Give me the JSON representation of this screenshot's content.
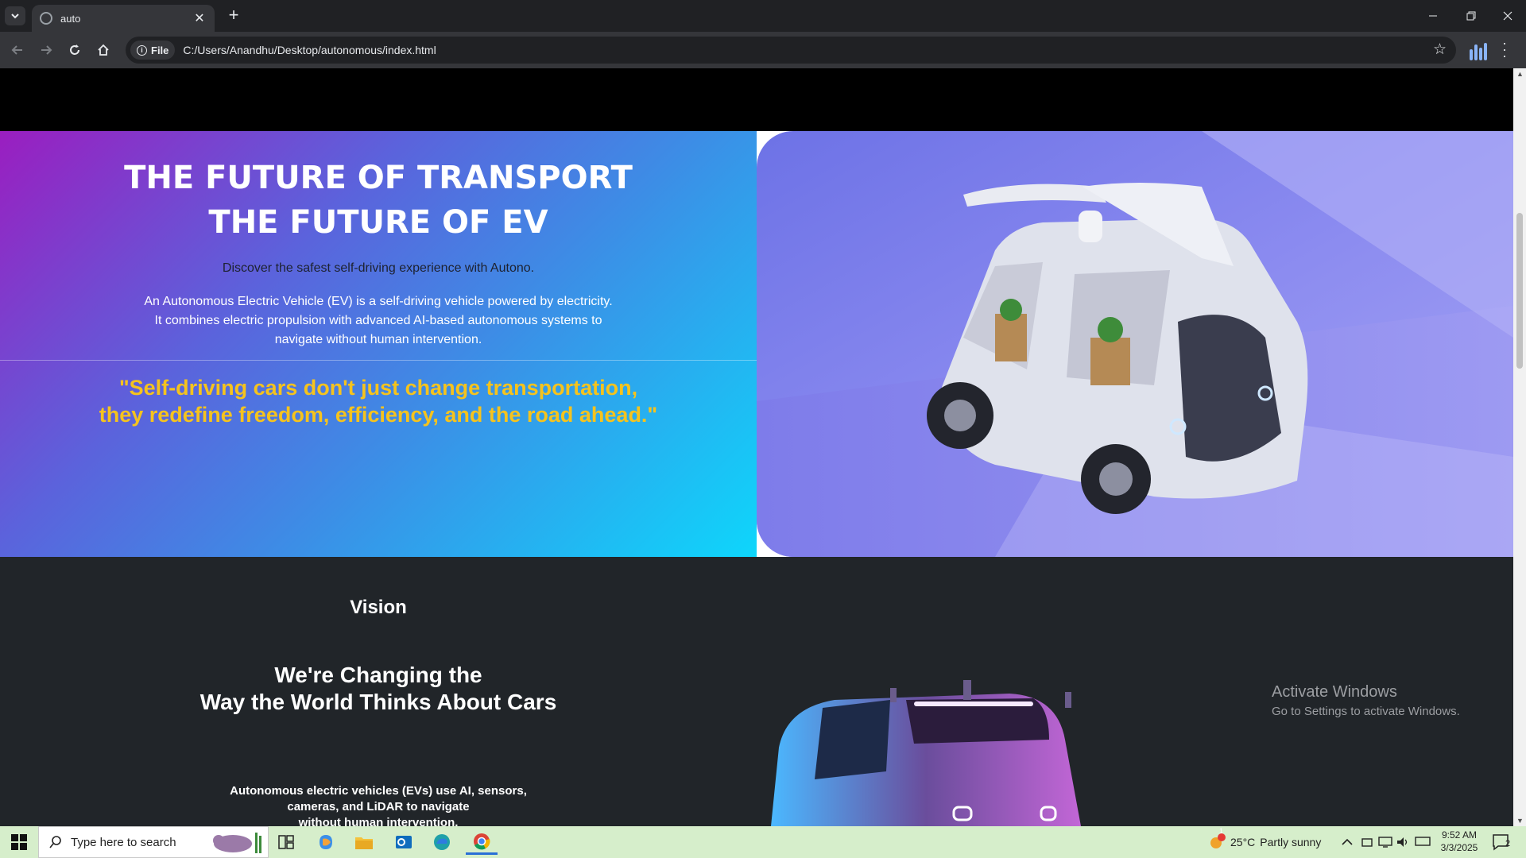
{
  "browser": {
    "tab_title": "auto",
    "new_tab": "+",
    "chip_label": "File",
    "url": "C:/Users/Anandhu/Desktop/autonomous/index.html"
  },
  "hero": {
    "title_line1": "THE FUTURE OF TRANSPORT",
    "title_line2": "THE FUTURE OF EV",
    "subtitle": "Discover the safest self-driving experience with Autono.",
    "desc_line1": "An Autonomous Electric Vehicle (EV) is a self-driving vehicle powered by electricity.",
    "desc_line2": "It combines electric propulsion with advanced AI-based autonomous systems to",
    "desc_line3": "navigate without human intervention.",
    "quote_line1": "\"Self-driving cars don't just change transportation,",
    "quote_line2": "they redefine freedom, efficiency, and the road ahead.\""
  },
  "vision": {
    "label": "Vision",
    "heading_line1": "We're Changing the",
    "heading_line2": "Way the World Thinks About Cars",
    "text_line1": "Autonomous electric vehicles (EVs) use AI, sensors,",
    "text_line2": "cameras, and LiDAR to navigate",
    "text_line3": "without human intervention."
  },
  "activate": {
    "title": "Activate Windows",
    "subtitle": "Go to Settings to activate Windows."
  },
  "taskbar": {
    "search_placeholder": "Type here to search",
    "temperature": "25°C",
    "weather": "Partly sunny",
    "weather_badge": "1",
    "time": "9:52 AM",
    "date": "3/3/2025",
    "notification_count": "2"
  },
  "colors": {
    "quote": "#f5c31e",
    "hero_gradient_start": "#9a1ec0",
    "hero_gradient_end": "#0ed6fb",
    "dark_section": "#212529"
  }
}
